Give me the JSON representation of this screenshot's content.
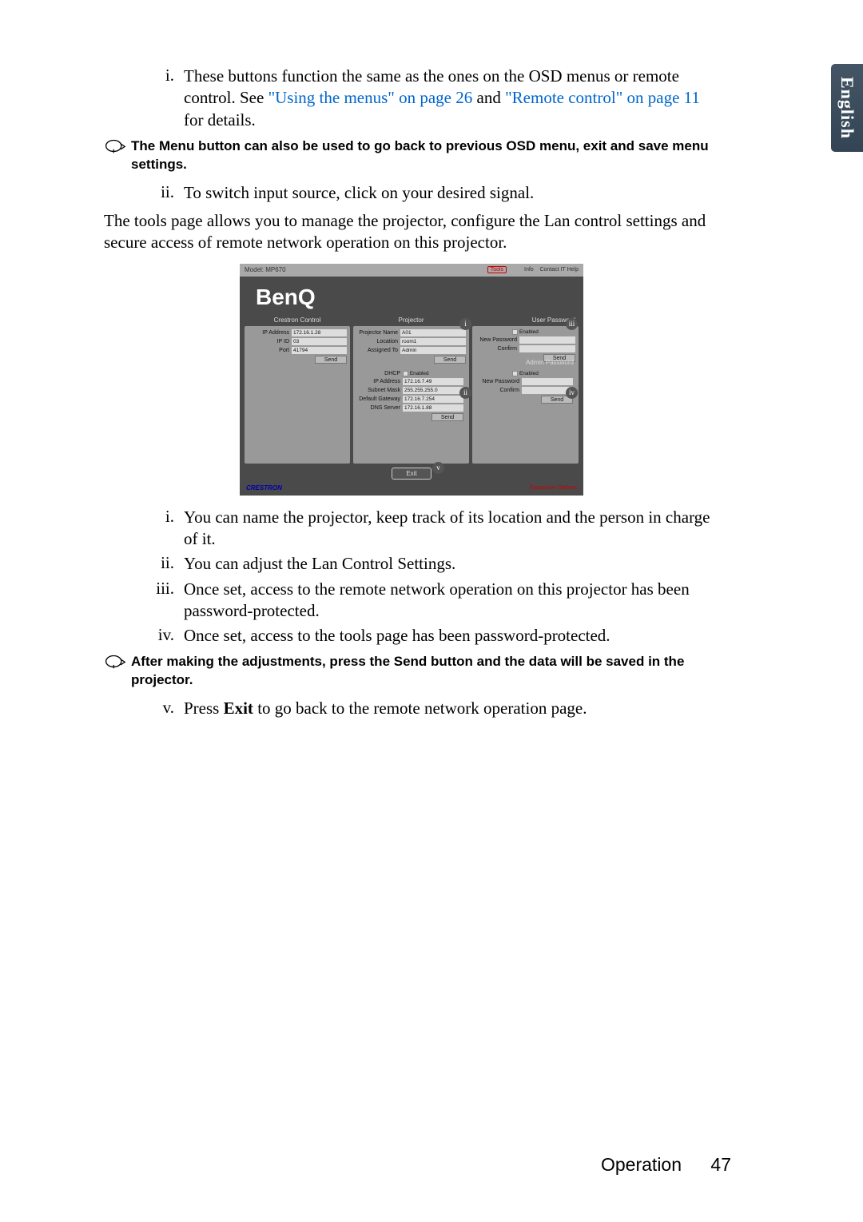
{
  "side_tab": "English",
  "intro_list": {
    "i": {
      "num": "i.",
      "text_a": "These buttons function the same as the ones on the OSD menus or remote control. See ",
      "link1": "\"Using the menus\" on page 26",
      "mid": " and ",
      "link2": "\"Remote control\" on page 11",
      "text_b": " for details."
    }
  },
  "note1": "The Menu button can also be used to go back to previous OSD menu, exit and save menu settings.",
  "list_ii": {
    "num": "ii.",
    "text": "To switch input source, click on your desired signal."
  },
  "tools_para": "The tools page allows you to manage the projector, configure the Lan control settings and secure access of remote network operation on this projector.",
  "screenshot": {
    "top_left": "Model: MP670",
    "top_right": {
      "tools": "Tools",
      "info": "Info",
      "contact": "Contact IT Help"
    },
    "logo": "BenQ",
    "crestron": {
      "title": "Crestron Control",
      "rows": [
        {
          "label": "IP Address",
          "value": "172.16.1.28"
        },
        {
          "label": "IP ID",
          "value": "03"
        },
        {
          "label": "Port",
          "value": "41794"
        }
      ],
      "send": "Send"
    },
    "projector": {
      "title": "Projector",
      "rows": [
        {
          "label": "Projector Name",
          "value": "A01"
        },
        {
          "label": "Location",
          "value": "room1"
        },
        {
          "label": "Assigned To",
          "value": "Admin"
        }
      ],
      "send": "Send",
      "lan": {
        "rows": [
          {
            "label": "DHCP",
            "value": "Enabled"
          },
          {
            "label": "IP Address",
            "value": "172.16.7.49"
          },
          {
            "label": "Subnet Mask",
            "value": "255.255.255.0"
          },
          {
            "label": "Default Gateway",
            "value": "172.16.7.254"
          },
          {
            "label": "DNS Server",
            "value": "172.16.1.88"
          }
        ],
        "send": "Send"
      }
    },
    "user_password": {
      "title": "User Password",
      "enabled": "Enabled",
      "rows": [
        {
          "label": "New Password",
          "value": ""
        },
        {
          "label": "Confirm",
          "value": ""
        }
      ],
      "send": "Send"
    },
    "admin_password": {
      "title": "Admin Password",
      "enabled": "Enabled",
      "rows": [
        {
          "label": "New Password",
          "value": ""
        },
        {
          "label": "Confirm",
          "value": ""
        }
      ],
      "send": "Send"
    },
    "exit": "Exit",
    "footer_left": "CRESTRON",
    "footer_right": "Expansion Options",
    "callouts": {
      "i": "i",
      "ii": "ii",
      "iii": "iii",
      "iv": "iv",
      "v": "v"
    }
  },
  "roman_list": {
    "i": {
      "num": "i.",
      "text": "You can name the projector, keep track of its location and the person in charge of it."
    },
    "ii": {
      "num": "ii.",
      "text": "You can adjust the Lan Control Settings."
    },
    "iii": {
      "num": "iii.",
      "text": "Once set, access to the remote network operation on this projector has been password-protected."
    },
    "iv": {
      "num": "iv.",
      "text": "Once set, access to the tools page has been password-protected."
    }
  },
  "note2": "After making the adjustments, press the Send button and the data will be saved in the projector.",
  "roman_v": {
    "num": "v.",
    "pre": "Press ",
    "bold": "Exit",
    "post": " to go back to the remote network operation page."
  },
  "footer": {
    "label": "Operation",
    "page": "47"
  }
}
